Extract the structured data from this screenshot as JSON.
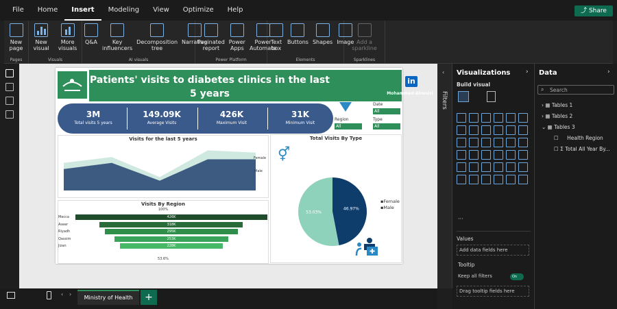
{
  "menu": [
    "File",
    "Home",
    "Insert",
    "Modeling",
    "View",
    "Optimize",
    "Help"
  ],
  "share_label": "Share",
  "ribbon": {
    "groups": [
      {
        "label": "Pages",
        "buttons": [
          "New page"
        ]
      },
      {
        "label": "Visuals",
        "buttons": [
          "New visual",
          "More visuals"
        ]
      },
      {
        "label": "AI visuals",
        "buttons": [
          "Q&A",
          "Key influencers",
          "Decomposition tree",
          "Narrative"
        ]
      },
      {
        "label": "Power Platform",
        "buttons": [
          "Paginated report",
          "Power Apps",
          "Power Automate"
        ]
      },
      {
        "label": "Elements",
        "buttons": [
          "Text box",
          "Buttons",
          "Shapes",
          "Image"
        ]
      },
      {
        "label": "Sparklines",
        "buttons": [
          "Add a sparkline"
        ]
      }
    ]
  },
  "report": {
    "title_line1": "Patients' visits to diabetes clinics in the last",
    "title_line2": "5 years",
    "author": "Mohammed-Alnosiri",
    "kpis": [
      {
        "value": "3M",
        "label": "Total visits 5 years"
      },
      {
        "value": "149.09K",
        "label": "Average Visits"
      },
      {
        "value": "426K",
        "label": "Maximum Visit"
      },
      {
        "value": "31K",
        "label": "Minimum Visit"
      }
    ],
    "slicers": {
      "date_label": "Date",
      "region_label": "Region",
      "type_label": "Type",
      "all": "All"
    },
    "area_chart": {
      "title": "Visits for the last 5 years",
      "female": "Female",
      "male": "Male"
    },
    "donut": {
      "title": "Total Visits By Type",
      "female": "Female",
      "male": "Male"
    },
    "funnel": {
      "title": "Visits By Region",
      "top_pct": "100%",
      "bottom_pct": "53.6%"
    }
  },
  "chart_data": [
    {
      "type": "area",
      "title": "Visits for the last 5 years",
      "series": [
        {
          "name": "Female",
          "values": [
            62,
            75,
            30,
            90,
            85
          ]
        },
        {
          "name": "Male",
          "values": [
            48,
            62,
            22,
            70,
            70
          ]
        }
      ]
    },
    {
      "type": "pie",
      "title": "Total Visits By Type",
      "labels": [
        "Male",
        "Female"
      ],
      "values": [
        46.97,
        53.03
      ]
    },
    {
      "type": "bar",
      "title": "Visits By Region",
      "categories": [
        "Mecca",
        "Aseer",
        "Riyadh",
        "Qassim",
        "Jizan"
      ],
      "values": [
        426,
        318,
        295,
        253,
        228
      ],
      "value_labels": [
        "426K",
        "318K",
        "295K",
        "253K",
        "228K"
      ]
    }
  ],
  "filters_label": "Filters",
  "viz_pane": {
    "title": "Visualizations",
    "build": "Build visual",
    "values": "Values",
    "add_data": "Add data fields here",
    "tooltip": "Tooltip",
    "keep_filters": "Keep all filters",
    "toggle": "On",
    "drag": "Drag tooltip fields here"
  },
  "data_pane": {
    "title": "Data",
    "search": "Search",
    "tables": [
      "Tables 1",
      "Tables 2",
      "Tables 3"
    ],
    "fields": [
      "Health Region",
      "Total All Year By..."
    ]
  },
  "page_tab": "Ministry of Health"
}
